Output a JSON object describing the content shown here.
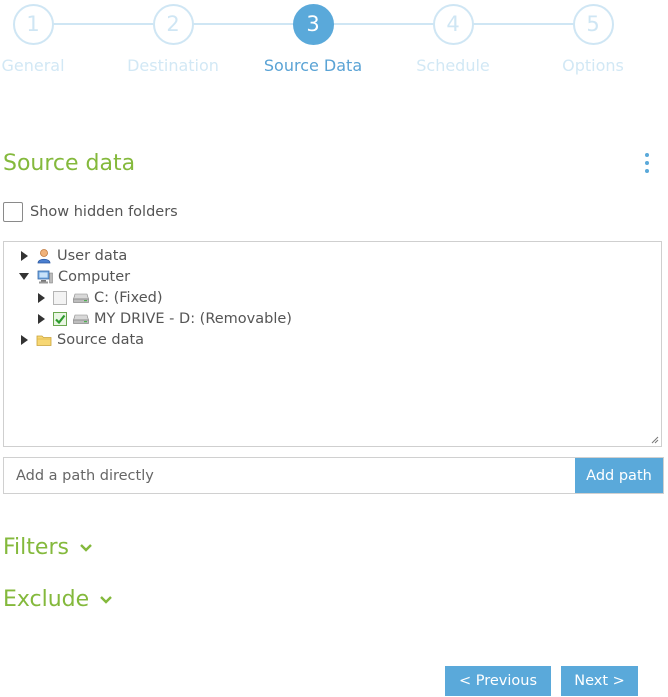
{
  "stepper": {
    "steps": [
      {
        "number": "1",
        "label": "General"
      },
      {
        "number": "2",
        "label": "Destination"
      },
      {
        "number": "3",
        "label": "Source Data"
      },
      {
        "number": "4",
        "label": "Schedule"
      },
      {
        "number": "5",
        "label": "Options"
      }
    ],
    "active_step": 3
  },
  "section": {
    "title": "Source data",
    "menu_icon": "kebab-menu-icon"
  },
  "hidden_folders": {
    "label": "Show hidden folders",
    "checked": false
  },
  "tree": {
    "items": [
      {
        "label": "User data",
        "icon": "user-icon",
        "expanded": false
      },
      {
        "label": "Computer",
        "icon": "computer-icon",
        "expanded": true
      },
      {
        "label": "C: (Fixed)",
        "icon": "drive-icon",
        "expanded": false,
        "checked": false
      },
      {
        "label": "MY DRIVE - D: (Removable)",
        "icon": "drive-icon",
        "expanded": false,
        "checked": true
      },
      {
        "label": "Source data",
        "icon": "folder-icon",
        "expanded": false
      }
    ]
  },
  "path": {
    "placeholder": "Add a path directly",
    "value": "",
    "button_label": "Add path"
  },
  "filters": {
    "label": "Filters",
    "expanded": false
  },
  "exclude": {
    "label": "Exclude",
    "expanded": false
  },
  "footer": {
    "previous_label": "< Previous",
    "next_label": "Next >"
  },
  "colors": {
    "accent_blue": "#5aa9da",
    "accent_green": "#84b93c",
    "inactive_step": "#cfe6f4"
  }
}
